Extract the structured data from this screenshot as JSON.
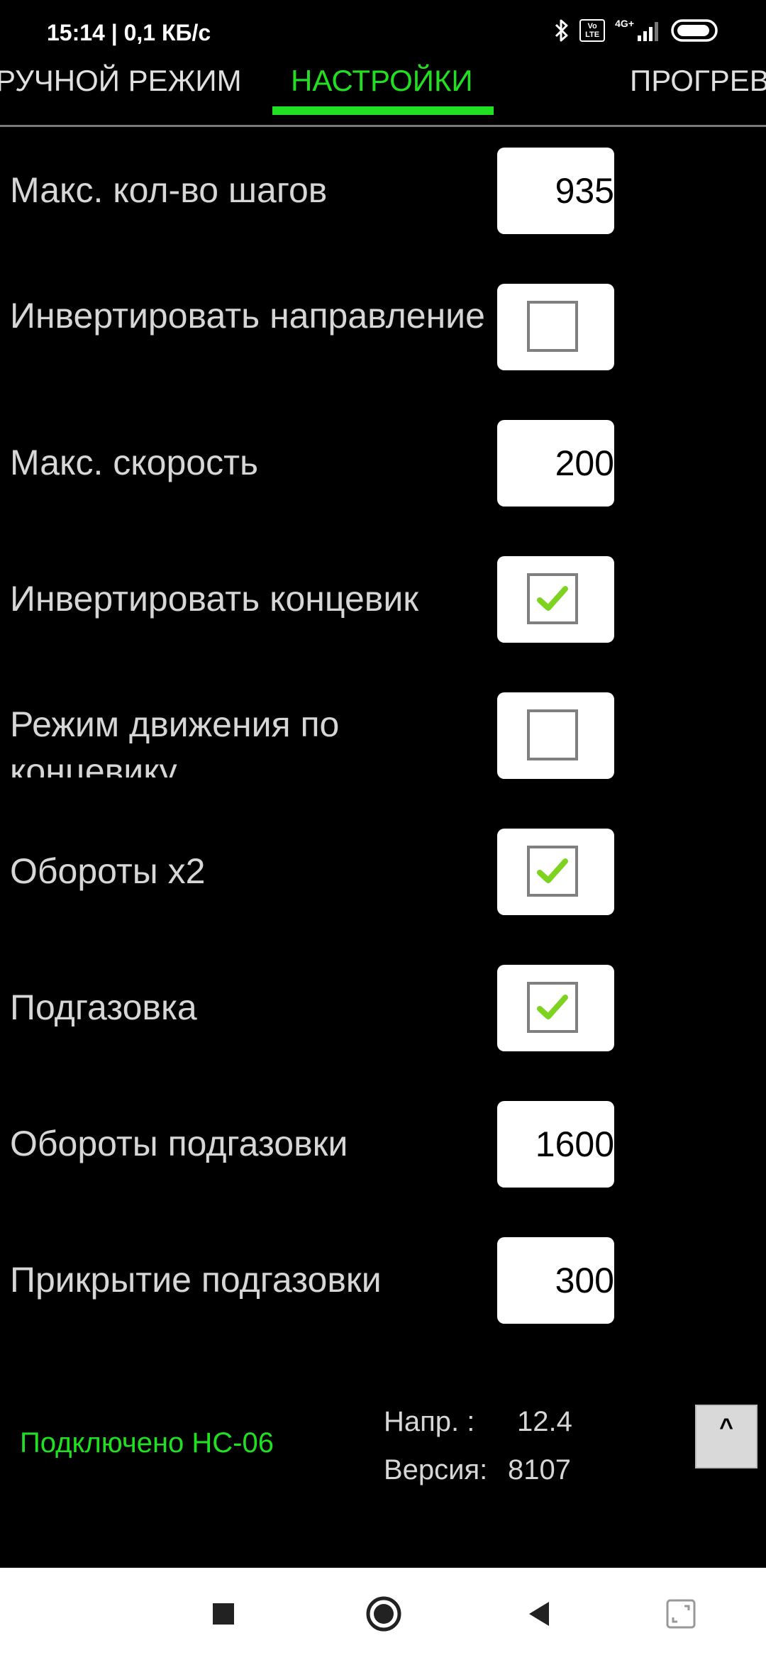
{
  "status_bar": {
    "time": "15:14 | 0,1 КБ/с",
    "volte": "Vo LTE",
    "network": "4G+",
    "icons": [
      "bluetooth-icon",
      "volte-icon",
      "signal-icon",
      "battery-icon"
    ]
  },
  "tabs": [
    {
      "label": "РУЧНОЙ РЕЖИМ",
      "active": false
    },
    {
      "label": "НАСТРОЙКИ",
      "active": true
    },
    {
      "label": "ПРОГРЕВ",
      "active": false
    }
  ],
  "settings": [
    {
      "label": "Макс. кол-во шагов",
      "type": "number",
      "value": "935"
    },
    {
      "label": "Инвертировать направление",
      "type": "checkbox",
      "checked": false
    },
    {
      "label": "Макс. скорость",
      "type": "number",
      "value": "200"
    },
    {
      "label": "Инвертировать концевик",
      "type": "checkbox",
      "checked": true
    },
    {
      "label": "Режим движения по концевику",
      "type": "checkbox",
      "checked": false
    },
    {
      "label": "Обороты x2",
      "type": "checkbox",
      "checked": true
    },
    {
      "label": "Подгазовка",
      "type": "checkbox",
      "checked": true
    },
    {
      "label": "Обороты подгазовки",
      "type": "number",
      "value": "1600"
    },
    {
      "label": "Прикрытие подгазовки",
      "type": "number",
      "value": "300"
    }
  ],
  "footer": {
    "connection": "Подключено HC-06",
    "voltage_label": "Напр. :",
    "voltage_value": "12.4",
    "version_label": "Версия:",
    "version_value": "8107",
    "scroll_top_label": "^"
  },
  "colors": {
    "accent": "#21e021",
    "background": "#000000",
    "text": "#d6d6d6",
    "check": "#7ed321"
  }
}
